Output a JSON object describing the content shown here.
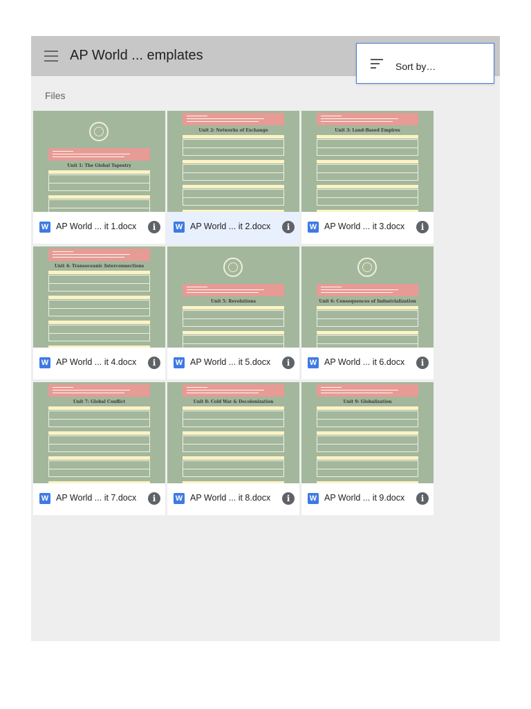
{
  "header": {
    "title": "AP World ... emplates",
    "menu_icon": "hamburger-menu-icon"
  },
  "sort_menu": {
    "label": "Sort by…",
    "icon": "sort-icon"
  },
  "section": {
    "label": "Files"
  },
  "colors": {
    "topbar": "#c7c7c7",
    "accent": "#4a78d6",
    "word_icon": "#3e7ae3",
    "thumbnail_bg": "#a3b79c",
    "banner": "#e79b95",
    "selected": "#e8f0fe"
  },
  "files": [
    {
      "name": "AP World ... it 1.docx",
      "icon": "W",
      "selected": false,
      "unit_title": "Unit 1: The Global Tapestry",
      "seal": true
    },
    {
      "name": "AP World ... it 2.docx",
      "icon": "W",
      "selected": true,
      "unit_title": "Unit 2: Networks of Exchange",
      "seal": false
    },
    {
      "name": "AP World ... it 3.docx",
      "icon": "W",
      "selected": false,
      "unit_title": "Unit 3: Land-Based Empires",
      "seal": false
    },
    {
      "name": "AP World ... it 4.docx",
      "icon": "W",
      "selected": false,
      "unit_title": "Unit 4: Transoceanic Interconnections",
      "seal": false
    },
    {
      "name": "AP World ... it 5.docx",
      "icon": "W",
      "selected": false,
      "unit_title": "Unit 5: Revolutions",
      "seal": true
    },
    {
      "name": "AP World ... it 6.docx",
      "icon": "W",
      "selected": false,
      "unit_title": "Unit 6: Consequences of Industrialization",
      "seal": true
    },
    {
      "name": "AP World ... it 7.docx",
      "icon": "W",
      "selected": false,
      "unit_title": "Unit 7: Global Conflict",
      "seal": false
    },
    {
      "name": "AP World ... it 8.docx",
      "icon": "W",
      "selected": false,
      "unit_title": "Unit 8: Cold War & Decolonization",
      "seal": false
    },
    {
      "name": "AP World ... it 9.docx",
      "icon": "W",
      "selected": false,
      "unit_title": "Unit 9: Globalization",
      "seal": false
    }
  ]
}
